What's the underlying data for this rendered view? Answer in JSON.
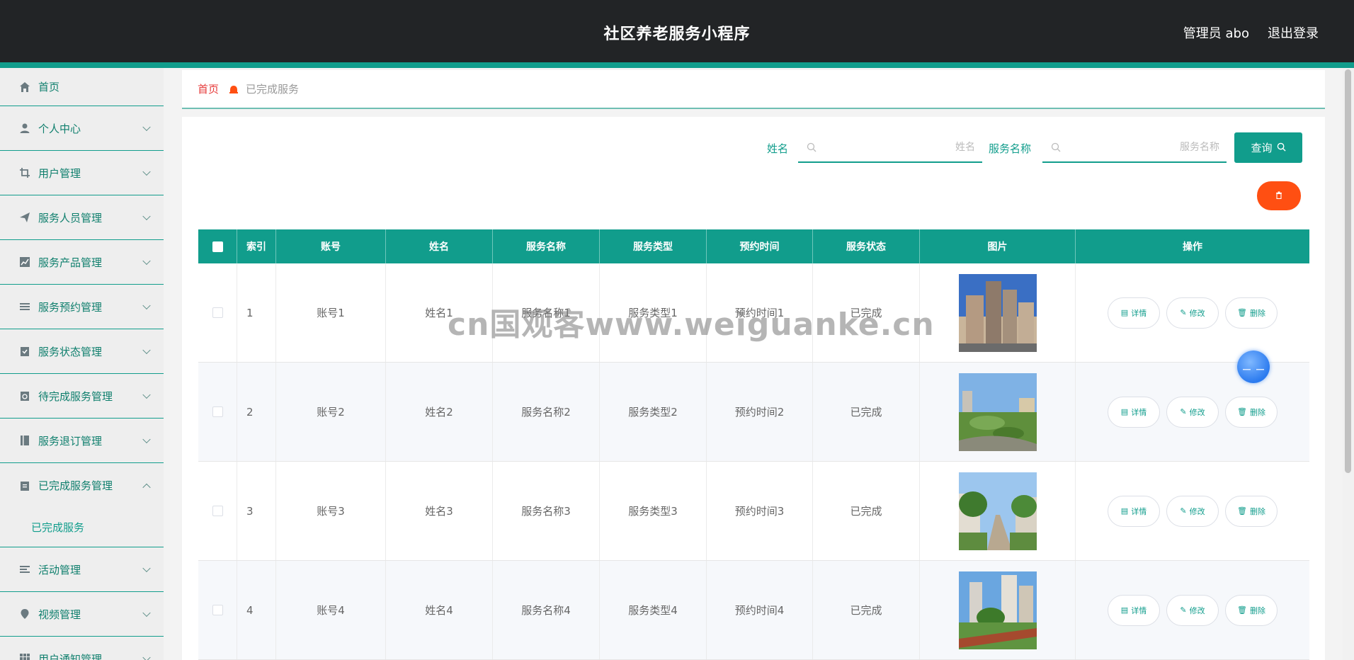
{
  "header": {
    "title": "社区养老服务小程序",
    "admin_label": "管理员 abo",
    "logout_label": "退出登录"
  },
  "sidebar": {
    "items": [
      {
        "label": "首页",
        "icon": "home-icon"
      },
      {
        "label": "个人中心",
        "icon": "user-icon"
      },
      {
        "label": "用户管理",
        "icon": "crop-icon"
      },
      {
        "label": "服务人员管理",
        "icon": "send-icon"
      },
      {
        "label": "服务产品管理",
        "icon": "chart-icon"
      },
      {
        "label": "服务预约管理",
        "icon": "list-icon"
      },
      {
        "label": "服务状态管理",
        "icon": "clipboard-check-icon"
      },
      {
        "label": "待完成服务管理",
        "icon": "clipboard-clock-icon"
      },
      {
        "label": "服务退订管理",
        "icon": "book-icon"
      },
      {
        "label": "已完成服务管理",
        "icon": "clipboard-icon"
      },
      {
        "label": "活动管理",
        "icon": "activity-list-icon"
      },
      {
        "label": "视频管理",
        "icon": "map-pin-icon"
      },
      {
        "label": "用户通知管理",
        "icon": "grid-icon"
      }
    ],
    "submenu": {
      "label": "已完成服务"
    }
  },
  "breadcrumb": {
    "home": "首页",
    "current": "已完成服务"
  },
  "search": {
    "name_label": "姓名",
    "name_placeholder": "姓名",
    "service_label": "服务名称",
    "service_placeholder": "服务名称",
    "query_label": "查询"
  },
  "table": {
    "headers": [
      "索引",
      "账号",
      "姓名",
      "服务名称",
      "服务类型",
      "预约时间",
      "服务状态",
      "图片",
      "操作"
    ],
    "rows": [
      {
        "index": "1",
        "account": "账号1",
        "name": "姓名1",
        "service": "服务名称1",
        "type": "服务类型1",
        "time": "预约时间1",
        "status": "已完成"
      },
      {
        "index": "2",
        "account": "账号2",
        "name": "姓名2",
        "service": "服务名称2",
        "type": "服务类型2",
        "time": "预约时间2",
        "status": "已完成"
      },
      {
        "index": "3",
        "account": "账号3",
        "name": "姓名3",
        "service": "服务名称3",
        "type": "服务类型3",
        "time": "预约时间3",
        "status": "已完成"
      },
      {
        "index": "4",
        "account": "账号4",
        "name": "姓名4",
        "service": "服务名称4",
        "type": "服务类型4",
        "time": "预约时间4",
        "status": "已完成"
      }
    ],
    "actions": {
      "detail": "详情",
      "edit": "修改",
      "delete": "删除"
    }
  },
  "watermark": "cn国观客www.weiguanke.cn",
  "colors": {
    "accent": "#119d8c",
    "header_bg": "#222426",
    "danger": "#ff4f12",
    "breadcrumb_home": "#e63a3a"
  }
}
